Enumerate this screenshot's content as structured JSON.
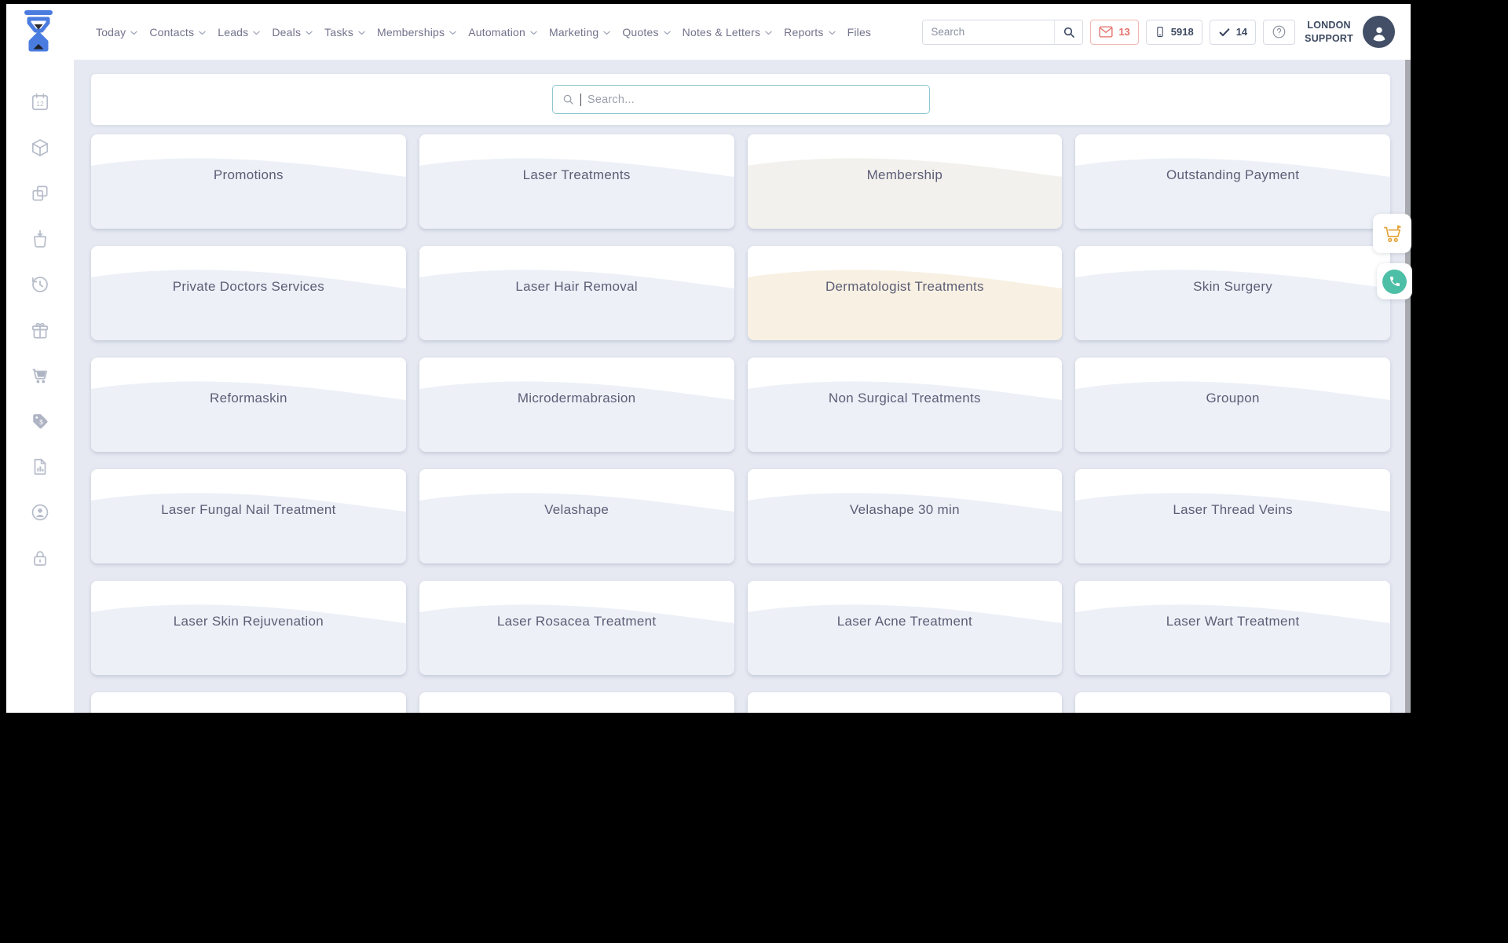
{
  "header": {
    "logo_icon": "hourglass-logo",
    "nav": [
      {
        "label": "Today",
        "has_dropdown": true
      },
      {
        "label": "Contacts",
        "has_dropdown": true
      },
      {
        "label": "Leads",
        "has_dropdown": true
      },
      {
        "label": "Deals",
        "has_dropdown": true
      },
      {
        "label": "Tasks",
        "has_dropdown": true
      },
      {
        "label": "Memberships",
        "has_dropdown": true
      },
      {
        "label": "Automation",
        "has_dropdown": true
      },
      {
        "label": "Marketing",
        "has_dropdown": true
      },
      {
        "label": "Quotes",
        "has_dropdown": true
      },
      {
        "label": "Notes & Letters",
        "has_dropdown": true
      },
      {
        "label": "Reports",
        "has_dropdown": true
      },
      {
        "label": "Files",
        "has_dropdown": false
      }
    ],
    "search": {
      "placeholder": "Search",
      "value": ""
    },
    "badges": [
      {
        "icon": "envelope-icon",
        "count": "13",
        "style": "danger"
      },
      {
        "icon": "mobile-phone-icon",
        "count": "5918",
        "style": "default"
      },
      {
        "icon": "checkmark-icon",
        "count": "14",
        "style": "default"
      }
    ],
    "help_icon": "question-mark-icon",
    "user": {
      "line1": "LONDON",
      "line2": "SUPPORT",
      "avatar_icon": "person-icon"
    }
  },
  "sidebar": {
    "items": [
      {
        "icon": "calendar"
      },
      {
        "icon": "package"
      },
      {
        "icon": "copy"
      },
      {
        "icon": "shopping-bag"
      },
      {
        "icon": "history"
      },
      {
        "icon": "gift"
      },
      {
        "icon": "cart"
      },
      {
        "icon": "price-tag"
      },
      {
        "icon": "report-document"
      },
      {
        "icon": "account"
      },
      {
        "icon": "lock"
      }
    ]
  },
  "main": {
    "search": {
      "placeholder": "Search...",
      "value": ""
    },
    "cards": [
      {
        "label": "Promotions",
        "tint": "#edf1f7"
      },
      {
        "label": "Laser Treatments",
        "tint": "#edf1f7"
      },
      {
        "label": "Membership",
        "tint": "#f2f1ed"
      },
      {
        "label": "Outstanding Payment",
        "tint": "#edf1f7"
      },
      {
        "label": "Private Doctors Services",
        "tint": "#edf1f7"
      },
      {
        "label": "Laser Hair Removal",
        "tint": "#edf1f7"
      },
      {
        "label": "Dermatologist Treatments",
        "tint": "#f8f1e3"
      },
      {
        "label": "Skin Surgery",
        "tint": "#edf1f7"
      },
      {
        "label": "Reformaskin",
        "tint": "#edf1f7"
      },
      {
        "label": "Microdermabrasion",
        "tint": "#edf1f7"
      },
      {
        "label": "Non Surgical Treatments",
        "tint": "#edf1f7"
      },
      {
        "label": "Groupon",
        "tint": "#edf1f7"
      },
      {
        "label": "Laser Fungal Nail Treatment",
        "tint": "#edf1f7"
      },
      {
        "label": "Velashape",
        "tint": "#edf1f7"
      },
      {
        "label": "Velashape 30 min",
        "tint": "#edf1f7"
      },
      {
        "label": "Laser Thread Veins",
        "tint": "#edf1f7"
      },
      {
        "label": "Laser Skin Rejuvenation",
        "tint": "#edf1f7"
      },
      {
        "label": "Laser Rosacea Treatment",
        "tint": "#edf1f7"
      },
      {
        "label": "Laser Acne Treatment",
        "tint": "#edf1f7"
      },
      {
        "label": "Laser Wart Treatment",
        "tint": "#edf1f7"
      },
      {
        "label": "",
        "tint": "#edf1f7"
      },
      {
        "label": "",
        "tint": "#edf1f7"
      },
      {
        "label": "",
        "tint": "#edf1f7"
      },
      {
        "label": "",
        "tint": "#edf1f7"
      }
    ]
  },
  "floating_buttons": [
    {
      "icon": "cart-gold"
    },
    {
      "icon": "whatsapp-phone"
    }
  ],
  "colors": {
    "brand_blue": "#4a7ce0",
    "nav_text": "#72728c",
    "card_text": "#5d5d76",
    "badge_red": "#e46f68",
    "badge_dark": "#3d4961",
    "search_focus_border": "#8ec6cf",
    "whatsapp_teal": "#4ebfa7",
    "cart_gold": "#e2a53c",
    "main_background": "#e6e9f2",
    "card_tint_default": "#edf1f7",
    "card_tint_cream": "#f8f1e3",
    "card_tint_gray": "#f2f1ed"
  }
}
